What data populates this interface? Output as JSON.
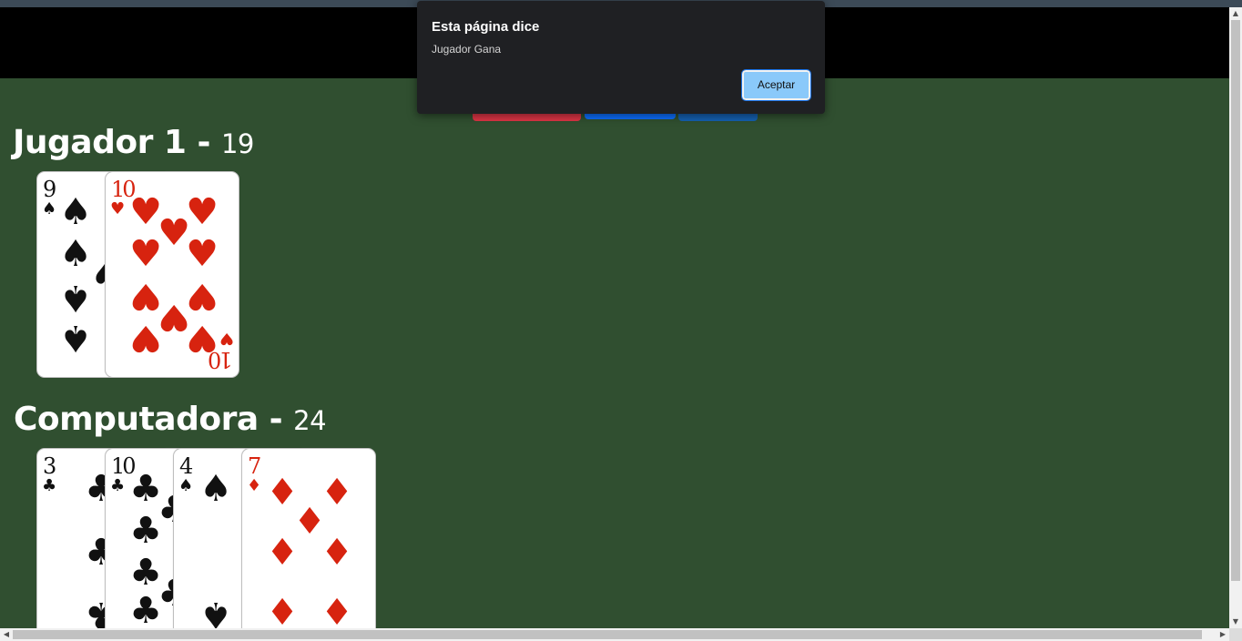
{
  "dialog": {
    "title": "Esta página dice",
    "message": "Jugador Gana",
    "ok_label": "Aceptar"
  },
  "players": [
    {
      "name": "Jugador 1 - ",
      "points": "19",
      "cards": [
        {
          "rank": "9",
          "suit_symbol": "♠",
          "color": "black"
        },
        {
          "rank": "10",
          "suit_symbol": "♥",
          "color": "red"
        }
      ]
    },
    {
      "name": "Computadora - ",
      "points": "24",
      "cards": [
        {
          "rank": "3",
          "suit_symbol": "♣",
          "color": "black"
        },
        {
          "rank": "10",
          "suit_symbol": "♣",
          "color": "black"
        },
        {
          "rank": "4",
          "suit_symbol": "♠",
          "color": "black"
        },
        {
          "rank": "7",
          "suit_symbol": "♦",
          "color": "red"
        }
      ]
    }
  ],
  "colors": {
    "table_green": "#304f30",
    "header_black": "#000000",
    "button_red": "#dc3545",
    "button_blue": "#0d6efd",
    "dialog_bg": "#1f2023",
    "dialog_button": "#8ac9fa"
  },
  "icons": {
    "scroll_up": "scroll-up-arrow-icon",
    "scroll_down": "scroll-down-arrow-icon",
    "scroll_left": "scroll-left-arrow-icon",
    "scroll_right": "scroll-right-arrow-icon"
  }
}
